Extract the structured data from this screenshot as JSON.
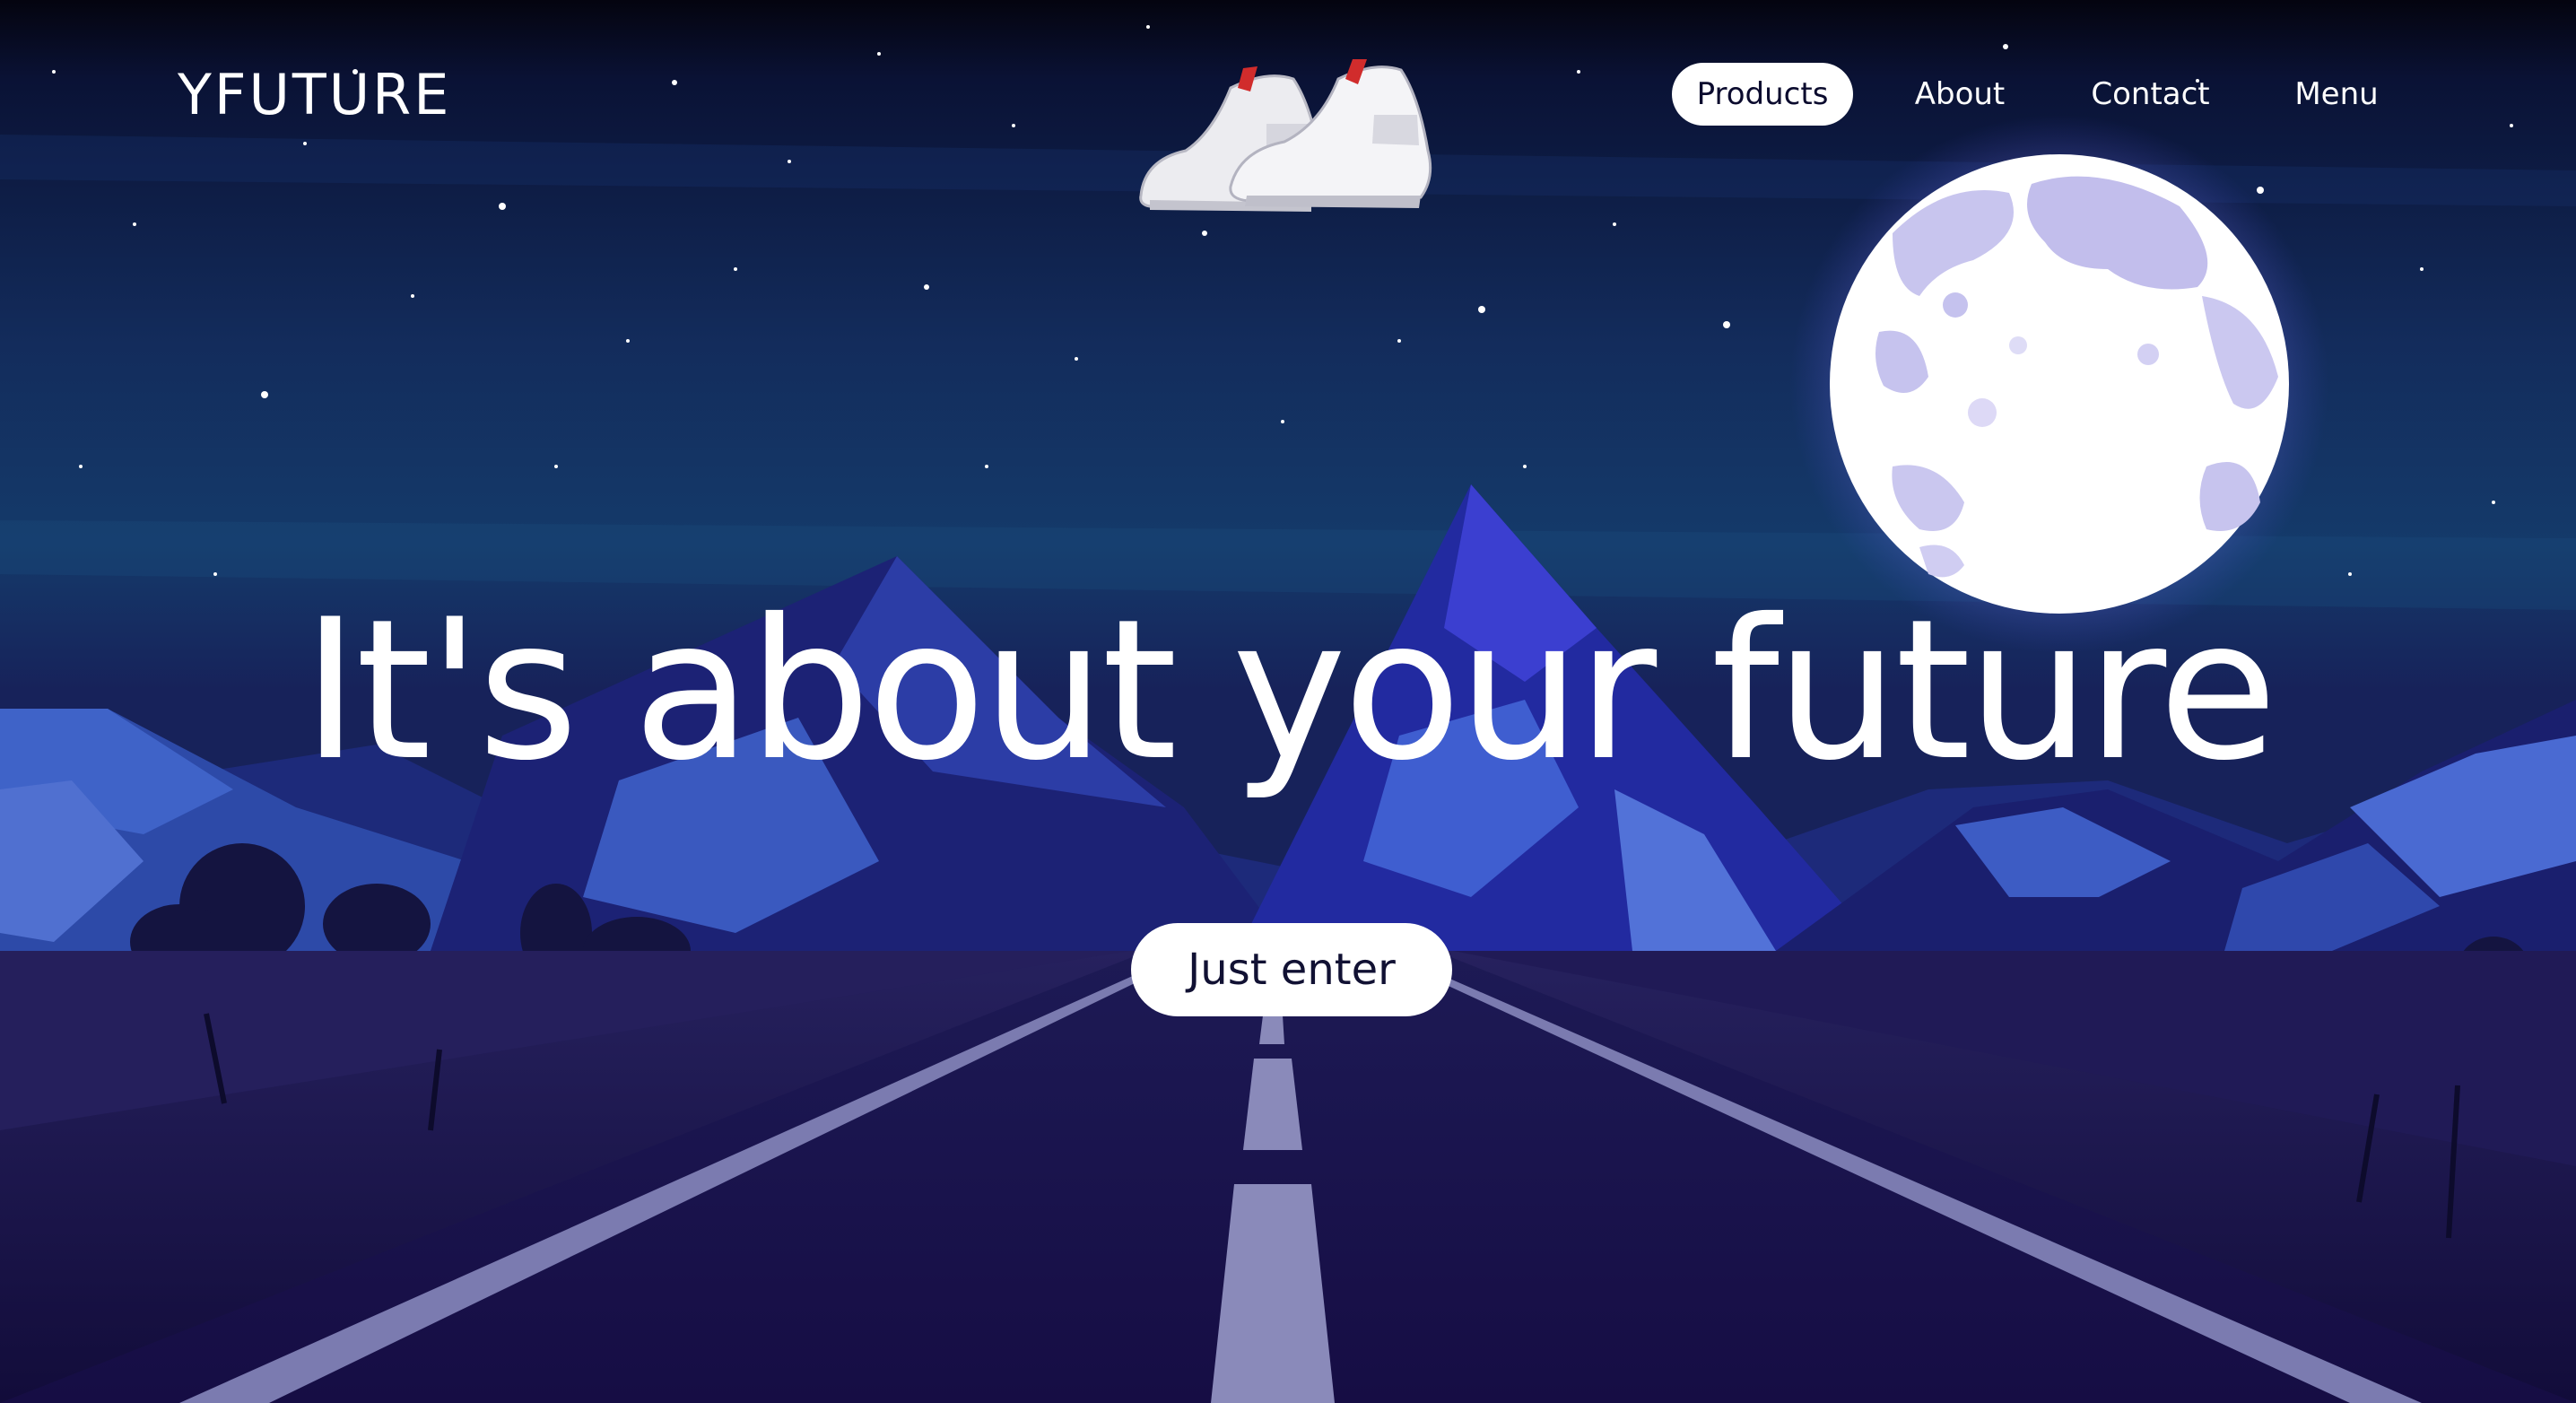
{
  "brand": {
    "logo_text": "YFUTURE"
  },
  "nav": {
    "items": [
      {
        "label": "Products",
        "active": true
      },
      {
        "label": "About",
        "active": false
      },
      {
        "label": "Contact",
        "active": false
      },
      {
        "label": "Menu",
        "active": false
      }
    ]
  },
  "hero": {
    "headline": "It's about your future",
    "cta_label": "Just enter",
    "product_image": "sneaker-pair-icon"
  },
  "colors": {
    "sky_top": "#050616",
    "sky_mid": "#132a5c",
    "mountain_light": "#3b5fc7",
    "mountain_dark": "#151a63",
    "road": "#1a1650",
    "moon": "#ffffff",
    "moon_craters": "#b9b6e6",
    "text": "#ffffff",
    "button_bg": "#ffffff",
    "button_text": "#111133"
  }
}
